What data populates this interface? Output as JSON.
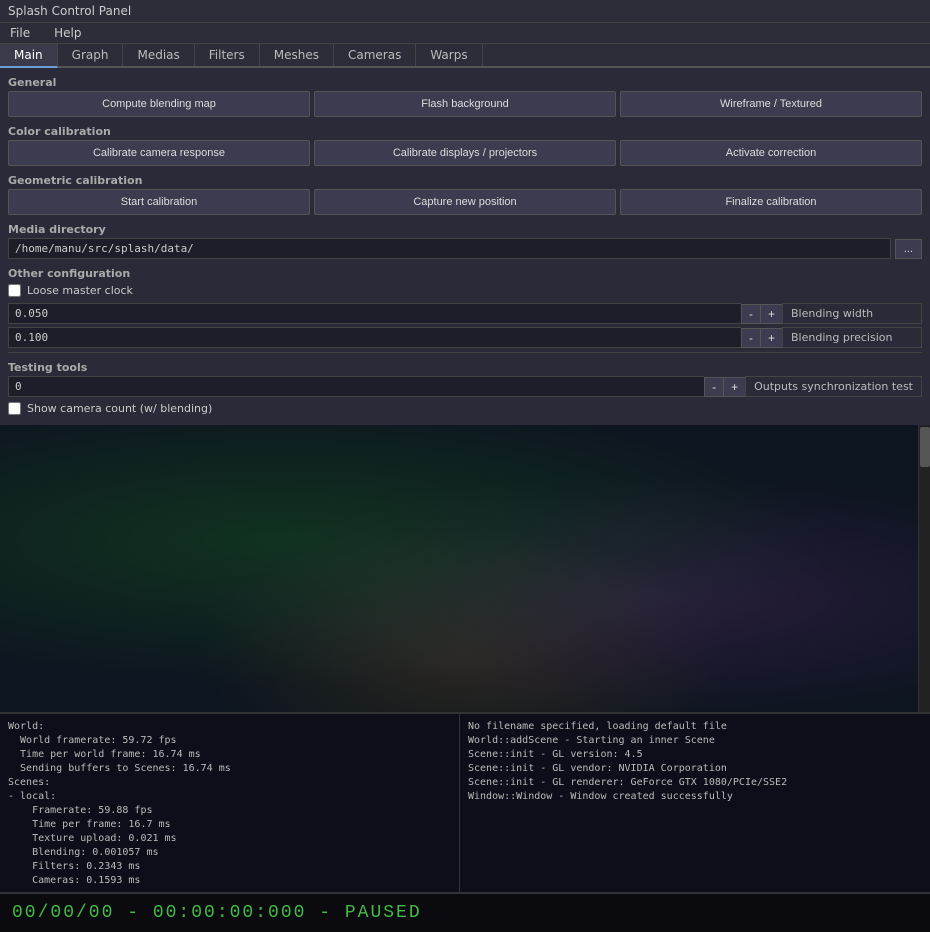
{
  "window": {
    "title": "Splash Control Panel"
  },
  "menu": {
    "items": [
      "File",
      "Help"
    ]
  },
  "tabs": {
    "items": [
      "Main",
      "Graph",
      "Medias",
      "Filters",
      "Meshes",
      "Cameras",
      "Warps"
    ],
    "active": "Main"
  },
  "general": {
    "label": "General",
    "buttons": [
      {
        "id": "compute-blending",
        "label": "Compute blending map"
      },
      {
        "id": "flash-background",
        "label": "Flash background"
      },
      {
        "id": "wireframe-textured",
        "label": "Wireframe / Textured"
      }
    ]
  },
  "color_calibration": {
    "label": "Color calibration",
    "buttons": [
      {
        "id": "calibrate-camera",
        "label": "Calibrate camera response"
      },
      {
        "id": "calibrate-displays",
        "label": "Calibrate displays / projectors"
      },
      {
        "id": "activate-correction",
        "label": "Activate correction"
      }
    ]
  },
  "geometric_calibration": {
    "label": "Geometric calibration",
    "buttons": [
      {
        "id": "start-calibration",
        "label": "Start calibration"
      },
      {
        "id": "capture-position",
        "label": "Capture new position"
      },
      {
        "id": "finalize-calibration",
        "label": "Finalize calibration"
      }
    ]
  },
  "media_directory": {
    "label": "Media directory",
    "path": "/home/manu/src/splash/data/",
    "browse_label": "..."
  },
  "other_config": {
    "label": "Other configuration",
    "loose_master_clock": {
      "label": "Loose master clock",
      "checked": false
    }
  },
  "blending_width": {
    "value": "0.050",
    "label": "Blending width",
    "minus": "-",
    "plus": "+"
  },
  "blending_precision": {
    "value": "0.100",
    "label": "Blending precision",
    "minus": "-",
    "plus": "+"
  },
  "testing_tools": {
    "label": "Testing tools",
    "sync_value": "0",
    "sync_label": "Outputs synchronization test",
    "sync_minus": "-",
    "sync_plus": "+",
    "show_camera": {
      "label": "Show camera count (w/ blending)",
      "checked": false
    }
  },
  "log_left": {
    "lines": [
      "World:",
      "  World framerate: 59.72 fps",
      "  Time per world frame: 16.74 ms",
      "  Sending buffers to Scenes: 16.74 ms",
      "Scenes:",
      "- local:",
      "    Framerate: 59.88 fps",
      "    Time per frame: 16.7 ms",
      "    Texture upload: 0.021 ms",
      "    Blending: 0.001057 ms",
      "    Filters: 0.2343 ms",
      "    Cameras: 0.1593 ms"
    ]
  },
  "log_right": {
    "lines": [
      "No filename specified, loading default file",
      "World::addScene - Starting an inner Scene",
      "Scene::init - GL version: 4.5",
      "Scene::init - GL vendor: NVIDIA Corporation",
      "Scene::init - GL renderer: GeForce GTX 1080/PCIe/SSE2",
      "Window::Window - Window created successfully"
    ]
  },
  "status_bar": {
    "text": "00/00/00 - 00:00:00:000 - PAUSED"
  }
}
